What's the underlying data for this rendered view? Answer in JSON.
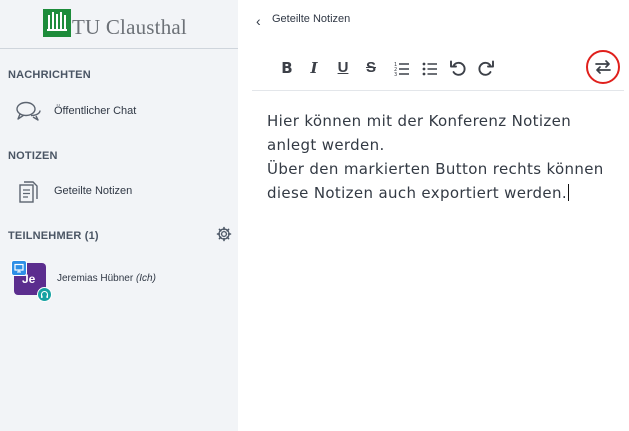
{
  "brand": {
    "logo_text": "TU Clausthal",
    "logo_color": "#1d8c3b"
  },
  "sidebar": {
    "sections": [
      {
        "title": "NACHRICHTEN"
      },
      {
        "title": "NOTIZEN"
      },
      {
        "title": "TEILNEHMER (1)"
      }
    ],
    "items": [
      {
        "label": "Öffentlicher Chat",
        "icon": "chat-icon"
      },
      {
        "label": "Geteilte Notizen",
        "icon": "notes-icon"
      }
    ],
    "participants": [
      {
        "initials": "Je",
        "name": "Jeremias Hübner",
        "self_tag": "(Ich)",
        "avatar_color": "#5b2d8e"
      }
    ]
  },
  "panel": {
    "title": "Geteilte Notizen",
    "toolbar": {
      "bold": "B",
      "italic": "I",
      "underline": "U",
      "strike": "S",
      "icons": [
        "ordered-list-icon",
        "bullet-list-icon",
        "undo-icon",
        "redo-icon",
        "export-icon"
      ],
      "highlight_color": "#e0201c"
    },
    "content_lines": [
      "Hier können mit der Konferenz Notizen",
      "anlegt werden.",
      "Über den markierten Button rechts können",
      "diese Notizen auch exportiert werden."
    ]
  }
}
